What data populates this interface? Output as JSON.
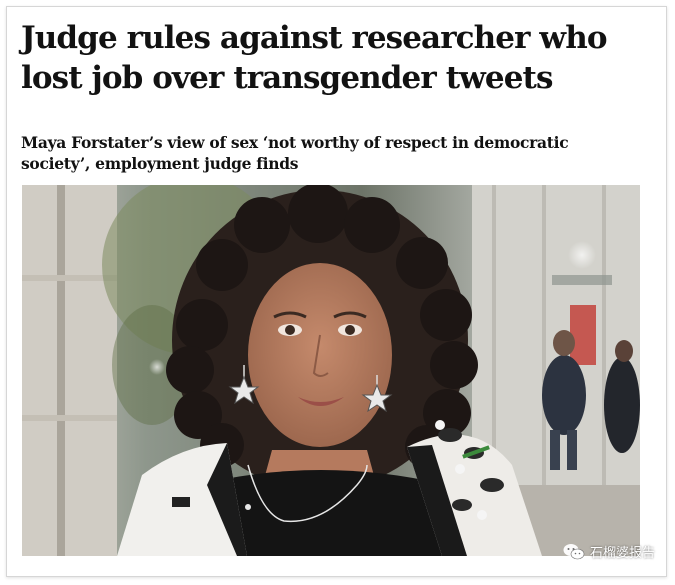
{
  "article": {
    "headline": "Judge rules against researcher who lost job over transgender tweets",
    "standfirst": "Maya Forstater’s view of sex ‘not worthy of respect in democratic society’, employment judge finds"
  },
  "photo": {
    "subject": "woman-portrait"
  },
  "watermark": {
    "text": "石榴婆报告",
    "icon": "wechat-icon"
  },
  "colors": {
    "text": "#121212",
    "background": "#ffffff"
  }
}
